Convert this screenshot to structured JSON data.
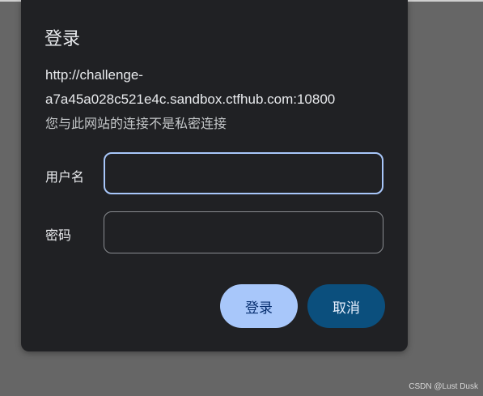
{
  "dialog": {
    "title": "登录",
    "url_line1": "http://challenge-",
    "url_line2": "a7a45a028c521e4c.sandbox.ctfhub.com:10800",
    "warning": "您与此网站的连接不是私密连接",
    "username_label": "用户名",
    "username_value": "",
    "password_label": "密码",
    "password_value": "",
    "login_button": "登录",
    "cancel_button": "取消"
  },
  "colors": {
    "backdrop": "#666666",
    "dialog_bg": "#202124",
    "primary_button": "#a8c7fa",
    "secondary_button": "#0b4f7d",
    "focus_border": "#a8c7fa"
  },
  "watermark": "CSDN @Lust Dusk"
}
